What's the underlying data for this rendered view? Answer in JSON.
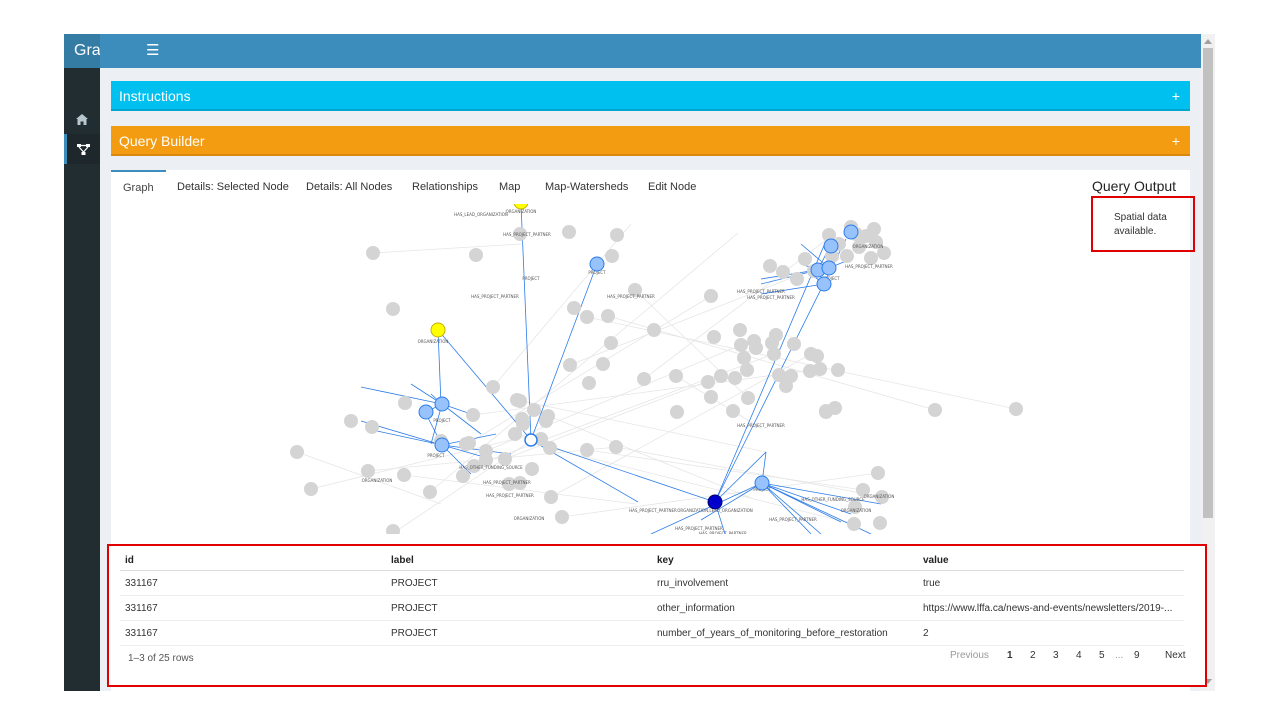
{
  "app": {
    "brand_text": "Gra",
    "sidebar": [
      {
        "icon": "home-icon"
      },
      {
        "icon": "graph-icon"
      }
    ]
  },
  "boxes": {
    "instructions": {
      "title": "Instructions",
      "toggle": "+"
    },
    "query_builder": {
      "title": "Query Builder",
      "toggle": "+"
    }
  },
  "tabs": [
    {
      "label": "Graph",
      "active": true
    },
    {
      "label": "Details: Selected Node"
    },
    {
      "label": "Details: All Nodes"
    },
    {
      "label": "Relationships"
    },
    {
      "label": "Map"
    },
    {
      "label": "Map-Watersheds"
    },
    {
      "label": "Edit Node"
    }
  ],
  "query_output": {
    "title": "Query Output",
    "spatial_line1": "Spatial data",
    "spatial_line2": "available."
  },
  "graph": {
    "node_labels": [
      "PROJECT",
      "ORGANIZATION",
      "ORGANIZATION,LEAD_ORGANIZATION"
    ],
    "edge_labels": [
      "HAS_PROJECT_PARTNER",
      "HAS_LEAD_ORGANIZATION",
      "HAS_OTHER_FUNDING_SOURCE"
    ],
    "colors": {
      "project": "#97c2fc",
      "project_border": "#2b7ce9",
      "selected": "#0000cc",
      "highlight": "#ffff00",
      "faded": "#d4d4d4",
      "edge_active": "#2b7ce9",
      "edge_faded": "#e6e6e6"
    }
  },
  "table": {
    "columns": [
      "id",
      "label",
      "key",
      "value"
    ],
    "rows": [
      {
        "id": "331167",
        "label": "PROJECT",
        "key": "rru_involvement",
        "value": "true"
      },
      {
        "id": "331167",
        "label": "PROJECT",
        "key": "other_information",
        "value": "https://www.lffa.ca/news-and-events/newsletters/2019-..."
      },
      {
        "id": "331167",
        "label": "PROJECT",
        "key": "number_of_years_of_monitoring_before_restoration",
        "value": "2"
      }
    ],
    "row_count": "1–3 of 25 rows",
    "pagination": {
      "previous": "Previous",
      "pages": [
        "1",
        "2",
        "3",
        "4",
        "5",
        "...",
        "9"
      ],
      "current": "1",
      "next": "Next"
    }
  }
}
